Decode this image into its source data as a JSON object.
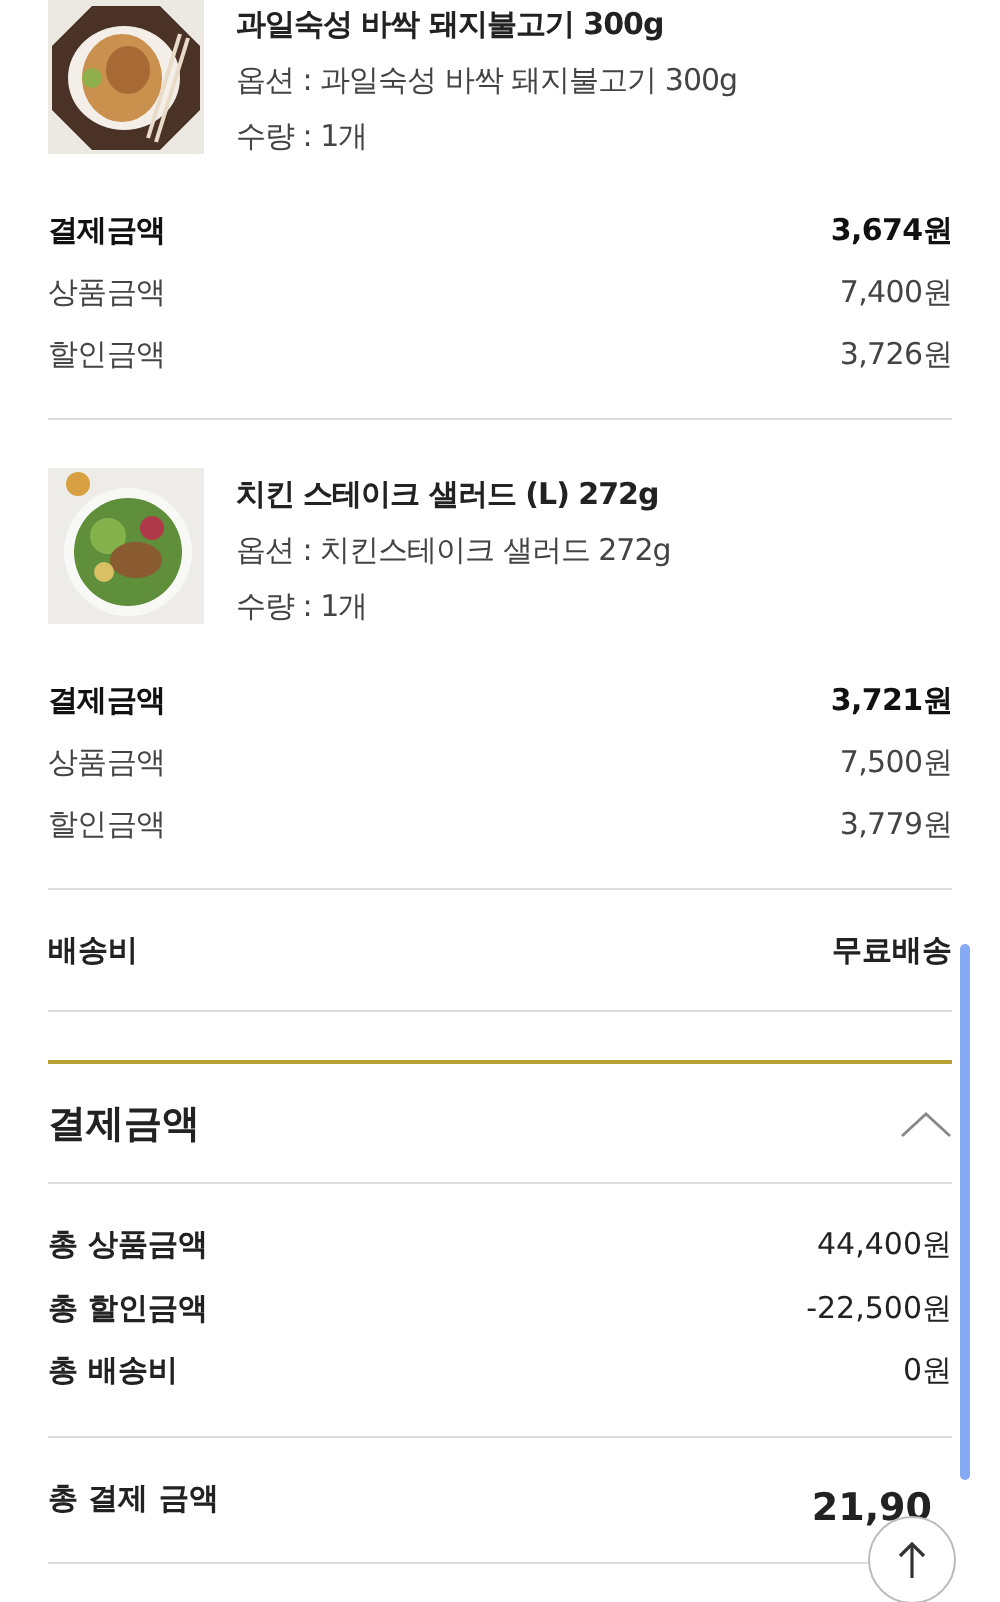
{
  "items": [
    {
      "title": "과일숙성 바싹 돼지불고기 300g",
      "option": "옵션 : 과일숙성 바싹 돼지불고기 300g",
      "quantity": "수량 : 1개",
      "rows": [
        {
          "kind": "total",
          "label": "결제금액",
          "value": "3,674원"
        },
        {
          "kind": "line",
          "label": "상품금액",
          "value": "7,400원"
        },
        {
          "kind": "line",
          "label": "할인금액",
          "value": "3,726원"
        }
      ]
    },
    {
      "title": "치킨 스테이크 샐러드 (L) 272g",
      "option": "옵션 : 치킨스테이크 샐러드 272g",
      "quantity": "수량 : 1개",
      "rows": [
        {
          "kind": "total",
          "label": "결제금액",
          "value": "3,721원"
        },
        {
          "kind": "line",
          "label": "상품금액",
          "value": "7,500원"
        },
        {
          "kind": "line",
          "label": "할인금액",
          "value": "3,779원"
        }
      ]
    }
  ],
  "shipping": {
    "label": "배송비",
    "value": "무료배송"
  },
  "summary": {
    "title": "결제금액",
    "expanded": true,
    "rows": [
      {
        "label": "총 상품금액",
        "value": "44,400원"
      },
      {
        "label": "총 할인금액",
        "value": "-22,500원"
      },
      {
        "label": "총 배송비",
        "value": "0원"
      }
    ],
    "total": {
      "label": "총 결제 금액",
      "value": "21,90"
    }
  }
}
